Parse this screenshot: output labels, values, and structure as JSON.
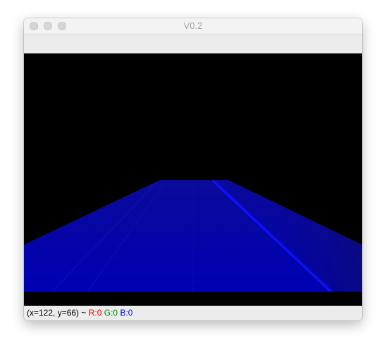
{
  "window": {
    "title": "V0.2"
  },
  "viewer": {
    "image_icon": "road-lane-render"
  },
  "status": {
    "coords": "(x=122, y=66)",
    "separator": "~",
    "r_label": "R:0",
    "g_label": "G:0",
    "b_label": "B:0",
    "colors": {
      "r": "#e00000",
      "g": "#008a00",
      "b": "#0000e6"
    }
  }
}
